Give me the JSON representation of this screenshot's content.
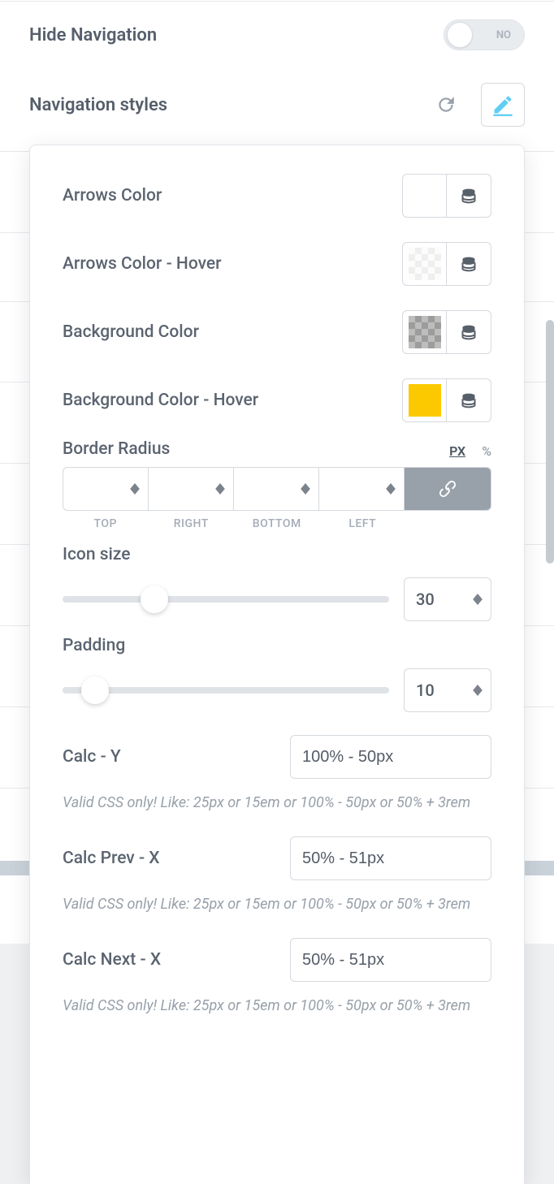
{
  "header": {
    "hide_nav_label": "Hide Navigation",
    "toggle_text": "NO",
    "nav_styles_label": "Navigation styles"
  },
  "colors": {
    "arrows": "Arrows Color",
    "arrows_hover": "Arrows Color - Hover",
    "bg": "Background Color",
    "bg_hover": "Background Color - Hover"
  },
  "border_radius": {
    "label": "Border Radius",
    "unit_px": "PX",
    "unit_pct": "%",
    "sides": {
      "top": "TOP",
      "right": "RIGHT",
      "bottom": "BOTTOM",
      "left": "LEFT"
    }
  },
  "sliders": {
    "icon_size_label": "Icon size",
    "icon_size_value": "30",
    "icon_size_pct": 28,
    "padding_label": "Padding",
    "padding_value": "10",
    "padding_pct": 10
  },
  "calc": {
    "y_label": "Calc - Y",
    "y_value": "100% - 50px",
    "prev_label": "Calc Prev - X",
    "prev_value": "50% - 51px",
    "next_label": "Calc Next - X",
    "next_value": "50% - 51px",
    "hint": "Valid CSS only! Like: 25px or 15em or 100% - 50px or 50% + 3rem"
  }
}
